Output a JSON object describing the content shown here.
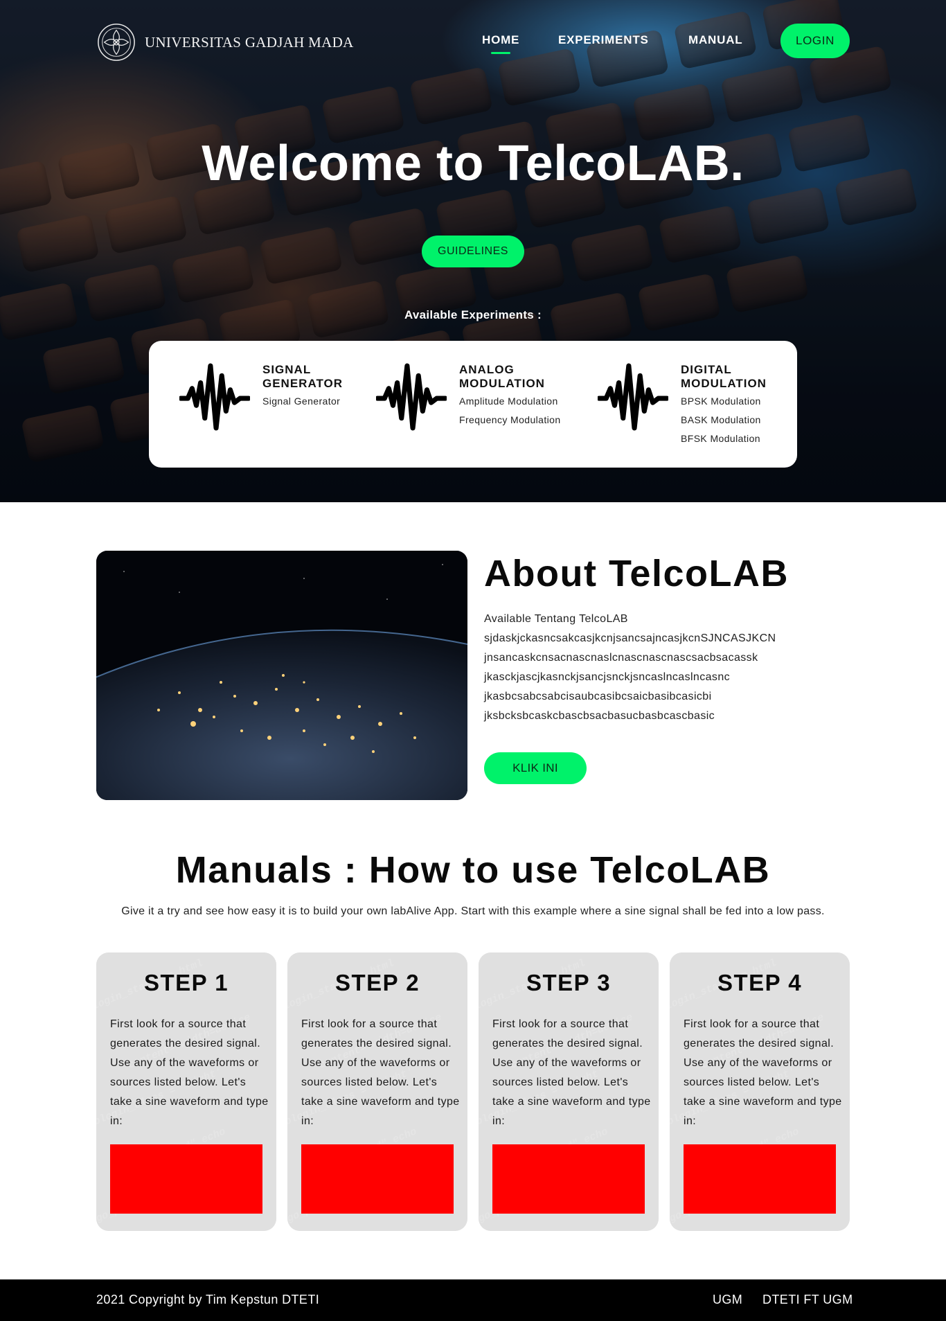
{
  "header": {
    "brand_name": "UNIVERSITAS GADJAH MADA",
    "logo_icon": "ugm-seal-icon",
    "nav": [
      {
        "label": "HOME",
        "active": true
      },
      {
        "label": "EXPERIMENTS",
        "active": false
      },
      {
        "label": "MANUAL",
        "active": false
      }
    ],
    "login_label": "LOGIN"
  },
  "hero": {
    "title_prefix": "Welcome to ",
    "title_bold": "TelcoLAB",
    "title_suffix": ".",
    "guidelines_label": "GUIDELINES",
    "experiments_label": "Available Experiments :"
  },
  "experiments": [
    {
      "icon": "waveform-icon",
      "title": "SIGNAL GENERATOR",
      "items": [
        "Signal Generator"
      ]
    },
    {
      "icon": "waveform-icon",
      "title": "ANALOG MODULATION",
      "items": [
        "Amplitude Modulation",
        "Frequency Modulation"
      ]
    },
    {
      "icon": "waveform-icon",
      "title": "DIGITAL MODULATION",
      "items": [
        "BPSK Modulation",
        "BASK Modulation",
        "BFSK Modulation"
      ]
    }
  ],
  "about": {
    "title_bold": "About",
    "title_rest": " TelcoLAB",
    "lines": [
      "Available Tentang TelcoLAB",
      "sjdaskjckasncsakcasjkcnjsancsajncasjkcnSJNCASJKCN",
      "jnsancaskcnsacnascnaslcnascnascnascsacbsacassk",
      "jkasckjascjkasnckjsancjsnckjsncaslncaslncasnc",
      "jkasbcsabcsabcisaubcasibcsaicbasibcasicbi",
      "jksbcksbcaskcbascbsacbasucbasbcascbasic"
    ],
    "button_label": "KLIK INI",
    "image_icon": "earth-at-night-photo"
  },
  "manuals": {
    "title_bold": "Manuals",
    "title_rest": " : How to use TelcoLAB",
    "description": "Give it a try and see how easy it is to build your own labAlive App. Start with this example where a sine signal shall be fed into a low pass.",
    "steps": [
      {
        "title": "STEP 1",
        "text": "First look for a source that generates the desired signal. Use any of the waveforms or sources listed below. Let's take a sine waveform and type in:"
      },
      {
        "title": "STEP 2",
        "text": "First look for a source that generates the desired signal. Use any of the waveforms or sources listed below. Let's take a sine waveform and type in:"
      },
      {
        "title": "STEP 3",
        "text": "First look for a source that generates the desired signal. Use any of the waveforms or sources listed below. Let's take a sine waveform and type in:"
      },
      {
        "title": "STEP 4",
        "text": "First look for a source that generates the desired signal. Use any of the waveforms or sources listed below. Let's take a sine waveform and type in:"
      }
    ],
    "placeholder_color": "#ff0000"
  },
  "footer": {
    "copyright": "2021 Copyright by Tim Kepstun DTETI",
    "links": [
      "UGM",
      "DTETI FT UGM"
    ]
  },
  "colors": {
    "accent": "#00f26a",
    "footer_bg": "#000000"
  }
}
